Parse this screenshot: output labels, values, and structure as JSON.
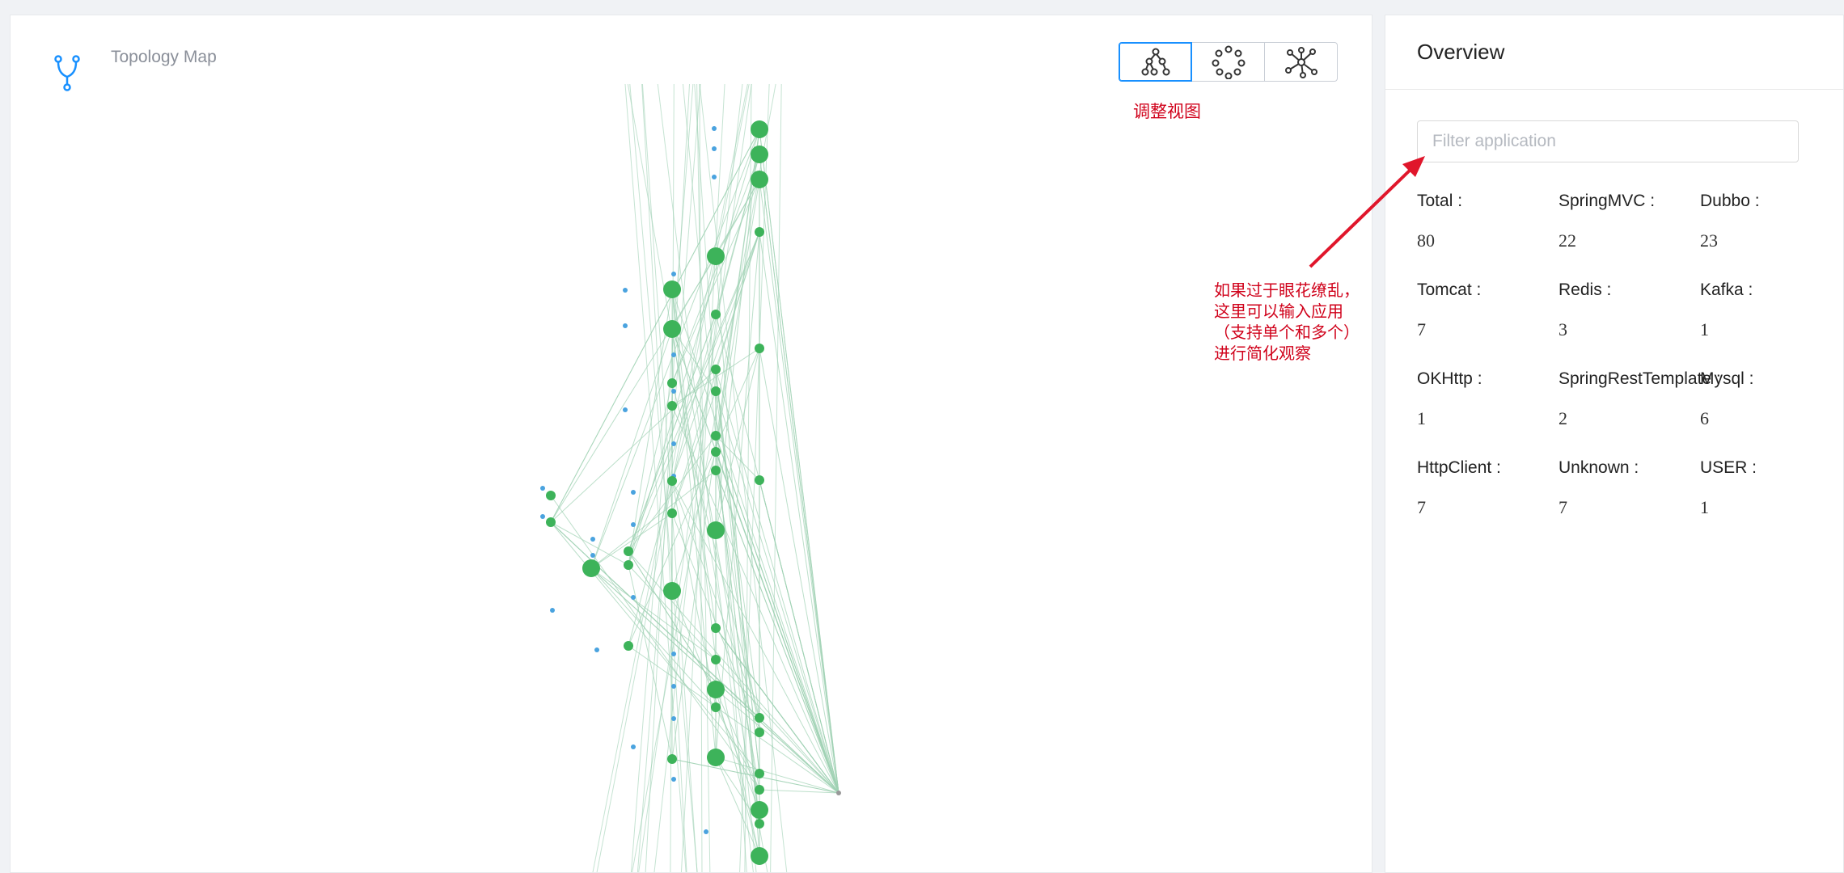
{
  "topology": {
    "title": "Topology Map",
    "icons": {
      "header": "branch-icon",
      "views": [
        "tree-layout-icon",
        "circle-layout-icon",
        "force-layout-icon"
      ]
    }
  },
  "annotations": {
    "view_note": "调整视图",
    "filter_note": "如果过于眼花缭乱，\n这里可以输入应用\n（支持单个和多个）\n进行简化观察",
    "color": "#d0021b"
  },
  "overview": {
    "title": "Overview",
    "filter_placeholder": "Filter application",
    "stats": [
      {
        "label": "Total :",
        "value": "80"
      },
      {
        "label": "SpringMVC :",
        "value": "22"
      },
      {
        "label": "Dubbo :",
        "value": "23"
      },
      {
        "label": "Tomcat :",
        "value": "7"
      },
      {
        "label": "Redis :",
        "value": "3"
      },
      {
        "label": "Kafka :",
        "value": "1"
      },
      {
        "label": "OKHttp :",
        "value": "1"
      },
      {
        "label": "SpringRestTemplate :",
        "value": "2"
      },
      {
        "label": "Mysql :",
        "value": "6"
      },
      {
        "label": "HttpClient :",
        "value": "7"
      },
      {
        "label": "Unknown :",
        "value": "7"
      },
      {
        "label": "USER :",
        "value": "1"
      }
    ]
  },
  "colors": {
    "node": "#3db35a",
    "edge": "#9fd1b4",
    "db_node": "#4aa3df",
    "active_border": "#1890ff",
    "header_icon": "#1890ff"
  }
}
